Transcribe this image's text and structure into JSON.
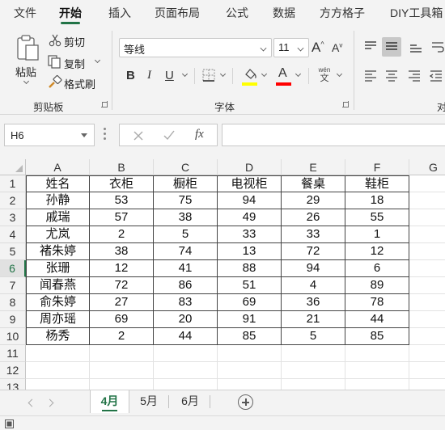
{
  "menu": {
    "tabs": [
      "文件",
      "开始",
      "插入",
      "页面布局",
      "公式",
      "数据",
      "方方格子",
      "DIY工具箱"
    ],
    "active_tab": "开始"
  },
  "ribbon": {
    "clipboard": {
      "paste_label": "粘贴",
      "cut_label": "剪切",
      "copy_label": "复制",
      "format_painter_label": "格式刷",
      "group_label": "剪贴板"
    },
    "font": {
      "font_name": "等线",
      "font_size": "11",
      "bold": "B",
      "italic": "I",
      "underline": "U",
      "grow_font": "A",
      "shrink_font": "A",
      "phonetic_top": "wén",
      "phonetic_bottom": "文",
      "group_label": "字体",
      "highlight_color": "#ffff00",
      "font_color": "#ff0000"
    },
    "alignment": {
      "group_label": "对"
    }
  },
  "formula_bar": {
    "name_box": "H6",
    "formula": ""
  },
  "sheet": {
    "columns": [
      "A",
      "B",
      "C",
      "D",
      "E",
      "F",
      "G"
    ],
    "row_numbers": [
      "1",
      "2",
      "3",
      "4",
      "5",
      "6",
      "7",
      "8",
      "9",
      "10",
      "11",
      "12",
      "13"
    ],
    "selected_row": "6",
    "rows": [
      [
        "姓名",
        "衣柜",
        "橱柜",
        "电视柜",
        "餐桌",
        "鞋柜"
      ],
      [
        "孙静",
        "53",
        "75",
        "94",
        "29",
        "18"
      ],
      [
        "戚瑞",
        "57",
        "38",
        "49",
        "26",
        "55"
      ],
      [
        "尤岚",
        "2",
        "5",
        "33",
        "33",
        "1"
      ],
      [
        "褚朱婷",
        "38",
        "74",
        "13",
        "72",
        "12"
      ],
      [
        "张珊",
        "12",
        "41",
        "88",
        "94",
        "6"
      ],
      [
        "闻春燕",
        "72",
        "86",
        "51",
        "4",
        "89"
      ],
      [
        "俞朱婷",
        "27",
        "83",
        "69",
        "36",
        "78"
      ],
      [
        "周亦瑶",
        "69",
        "20",
        "91",
        "21",
        "44"
      ],
      [
        "杨秀",
        "2",
        "44",
        "85",
        "5",
        "85"
      ]
    ]
  },
  "sheet_tabs": {
    "tabs": [
      "4月",
      "5月",
      "6月"
    ],
    "active": "4月"
  },
  "colors": {
    "accent": "#217346",
    "ribbon_bg": "#f3f3f3"
  }
}
